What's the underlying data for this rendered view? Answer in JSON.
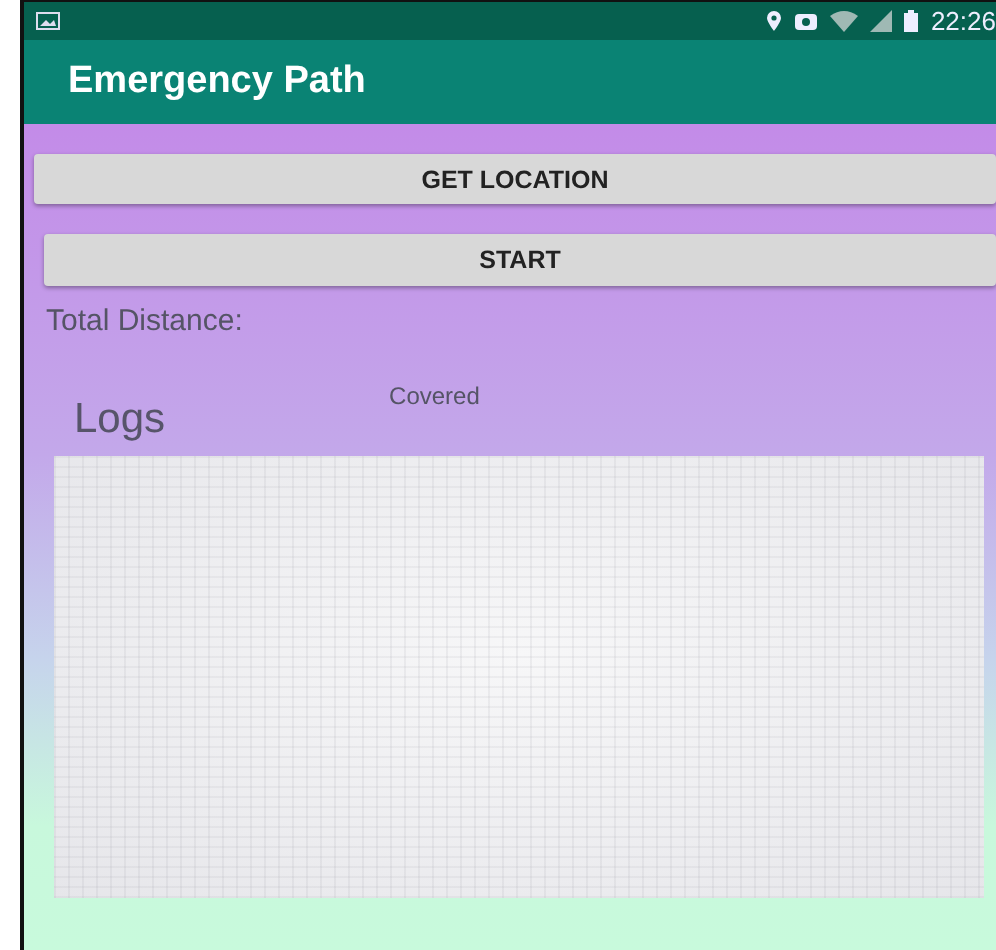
{
  "status_bar": {
    "time": "22:26"
  },
  "app_bar": {
    "title": "Emergency Path"
  },
  "buttons": [
    {
      "label": "GET LOCATION"
    },
    {
      "label": "START"
    }
  ],
  "total_distance": {
    "label": "Total Distance:"
  },
  "logs": {
    "title": "Logs",
    "note": "Covered"
  }
}
